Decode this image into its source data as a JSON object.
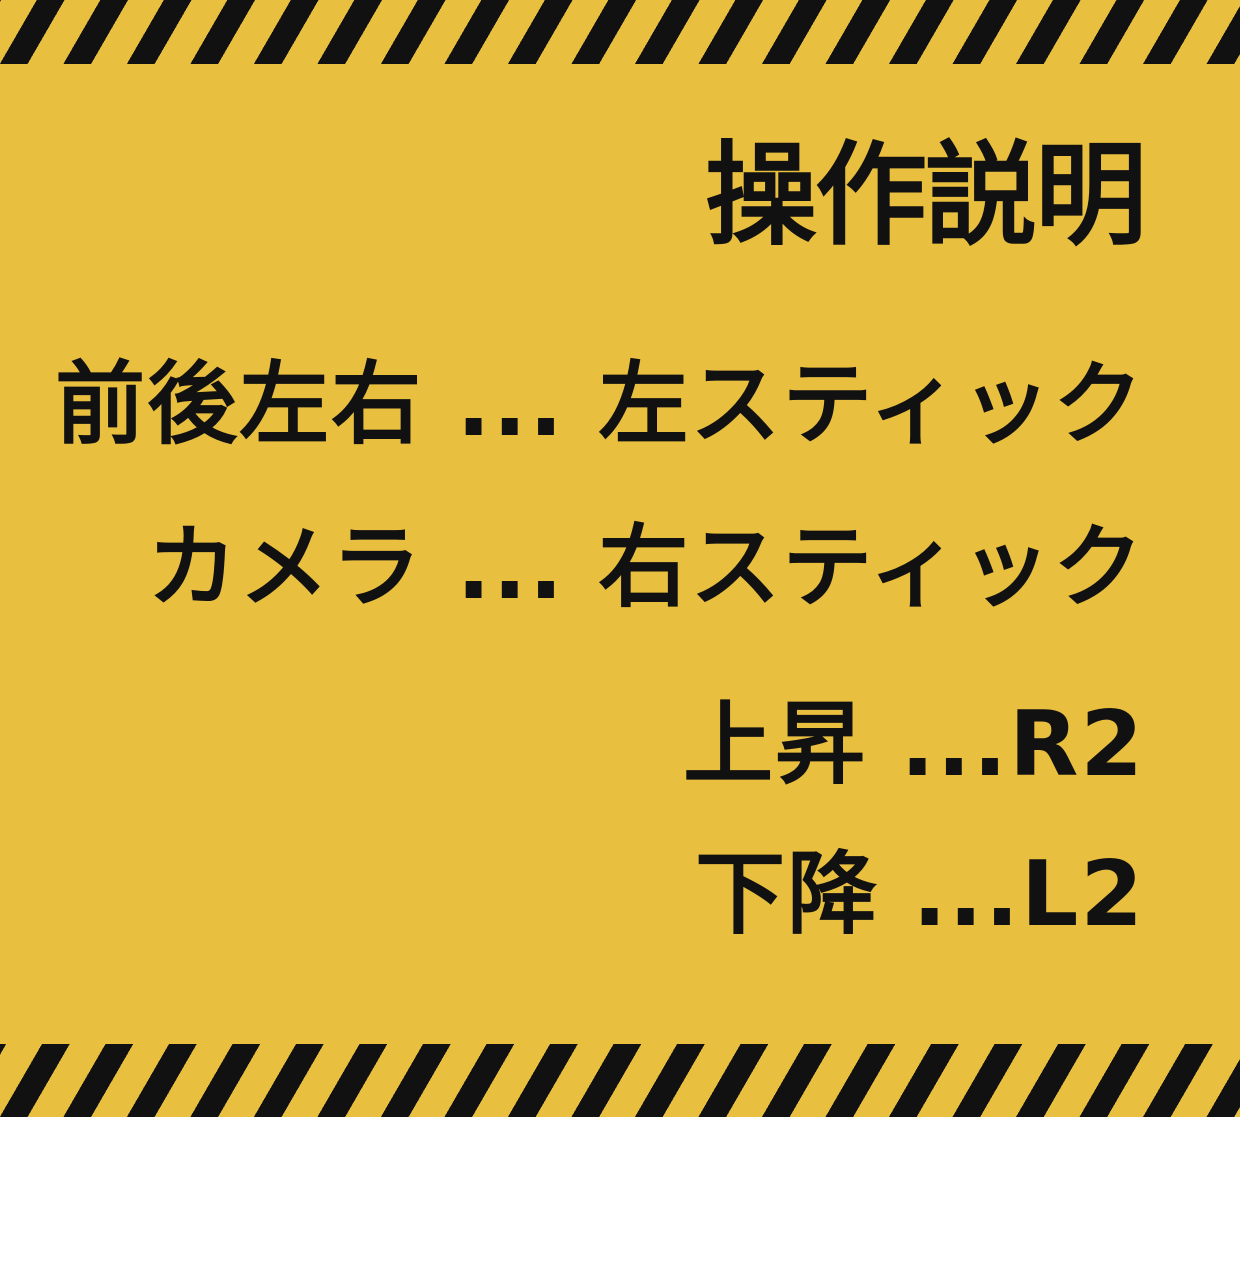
{
  "sign": {
    "title": "操作説明",
    "controls": [
      {
        "text": "前後左右 ... 左スティック"
      },
      {
        "text": "カメラ ... 右スティック"
      },
      {
        "text": "上昇 ...R2"
      },
      {
        "text": "下降 ...L2"
      }
    ]
  },
  "colors": {
    "panel_background": "#e9bf3f",
    "stripe": "#111111",
    "text": "#111111",
    "page_background": "#ffffff"
  }
}
